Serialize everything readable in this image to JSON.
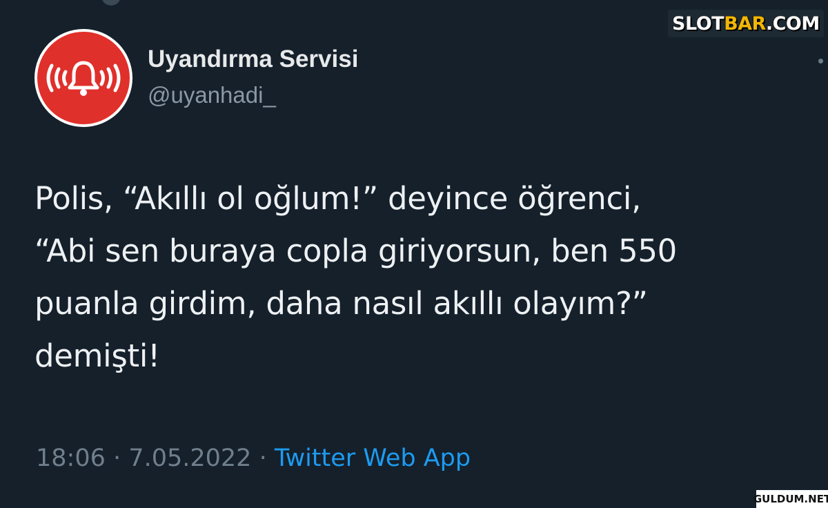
{
  "watermark_top": {
    "main": "SLOT",
    "accent": "BAR",
    "suffix": ".COM"
  },
  "watermark_bottom": "GULDUM.NET",
  "colors": {
    "background": "#15202b",
    "avatar_red": "#e0302b",
    "link_blue": "#1d9bf0"
  },
  "tweet": {
    "author": {
      "display_name": "Uyandırma Servisi",
      "handle": "@uyanhadi_",
      "avatar_icon": "alarm-bell-icon"
    },
    "text_lines": [
      "Polis, “Akıllı ol oğlum!” deyince öğrenci,",
      "“Abi sen buraya copla giriyorsun, ben 550",
      "puanla girdim, daha nasıl akıllı olayım?”",
      "demişti!"
    ],
    "time": "18:06",
    "separator": "·",
    "date": "7.05.2022",
    "source": "Twitter Web App"
  }
}
